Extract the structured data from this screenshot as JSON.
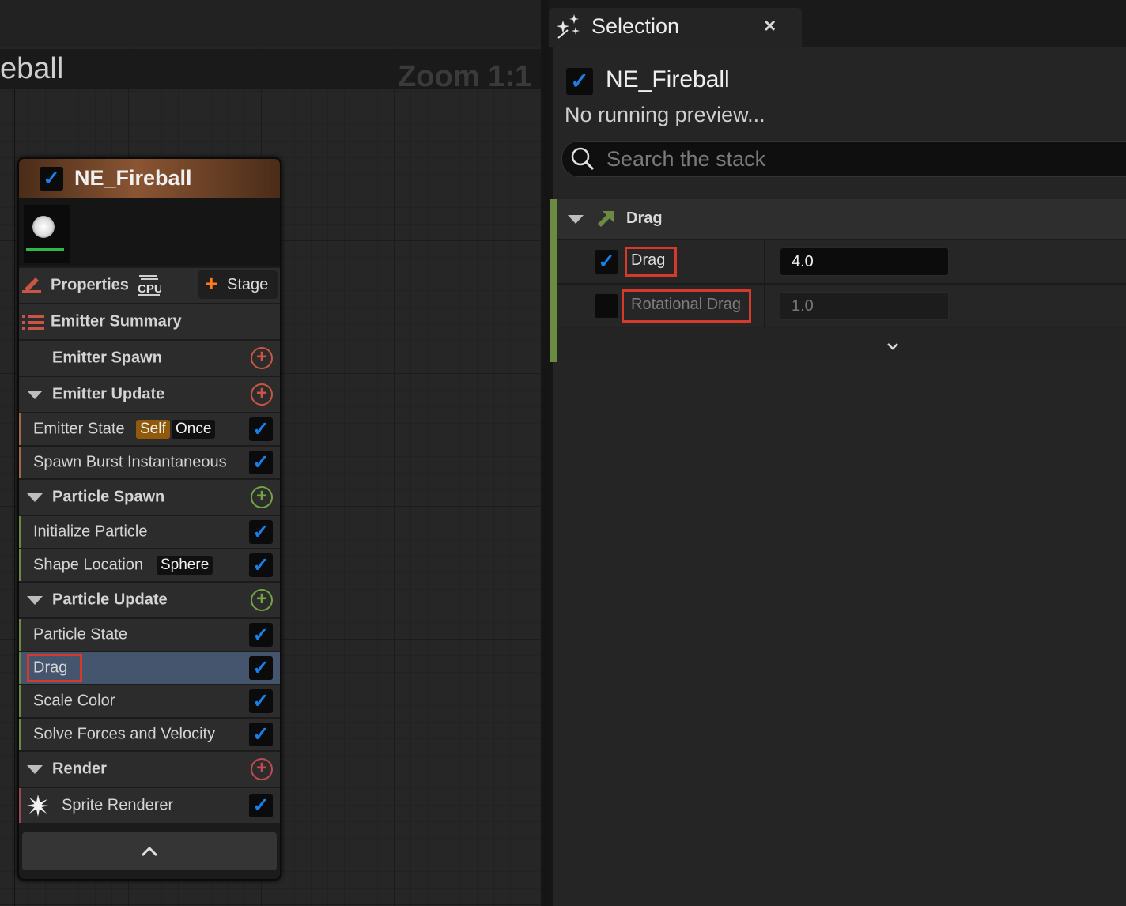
{
  "graph": {
    "title": "eball",
    "zoom": "Zoom 1:1"
  },
  "node": {
    "title": "NE_Fireball",
    "enabled": true,
    "properties_label": "Properties",
    "cpu_label": "CPU",
    "stage_label": "Stage",
    "emitter_summary": "Emitter Summary",
    "emitter_spawn": "Emitter Spawn",
    "emitter_update": "Emitter Update",
    "emitter_state": "Emitter State",
    "emitter_state_tag1": "Self",
    "emitter_state_tag2": "Once",
    "spawn_burst": "Spawn Burst Instantaneous",
    "particle_spawn": "Particle Spawn",
    "initialize_particle": "Initialize Particle",
    "shape_location": "Shape Location",
    "shape_location_tag": "Sphere",
    "particle_update": "Particle Update",
    "particle_state": "Particle State",
    "drag": "Drag",
    "scale_color": "Scale Color",
    "solve_forces": "Solve Forces and Velocity",
    "render": "Render",
    "sprite_renderer": "Sprite Renderer",
    "colors": {
      "header": "#8a5533",
      "update_accent": "#a06a4a",
      "spawn_accent": "#6b8a42",
      "render_accent": "#9a4a55",
      "selected": "#44556d",
      "highlight": "#d63a2b",
      "check": "#1a7fe8"
    }
  },
  "panel": {
    "tab_title": "Selection",
    "close_glyph": "×",
    "selection_name": "NE_Fireball",
    "status": "No running preview...",
    "search_placeholder": "Search the stack",
    "module_title": "Drag",
    "params": [
      {
        "name": "Drag",
        "value": "4.0",
        "enabled": true
      },
      {
        "name": "Rotational Drag",
        "value": "1.0",
        "enabled": false
      }
    ]
  },
  "icons": [
    "checkmark-icon",
    "cpu-icon",
    "pencil-icon",
    "list-icon",
    "plus-circle-icon",
    "sprite-icon",
    "chevron-up-icon",
    "chevron-down-icon",
    "search-icon",
    "sparkle-icon",
    "close-icon",
    "module-arrow-icon"
  ]
}
